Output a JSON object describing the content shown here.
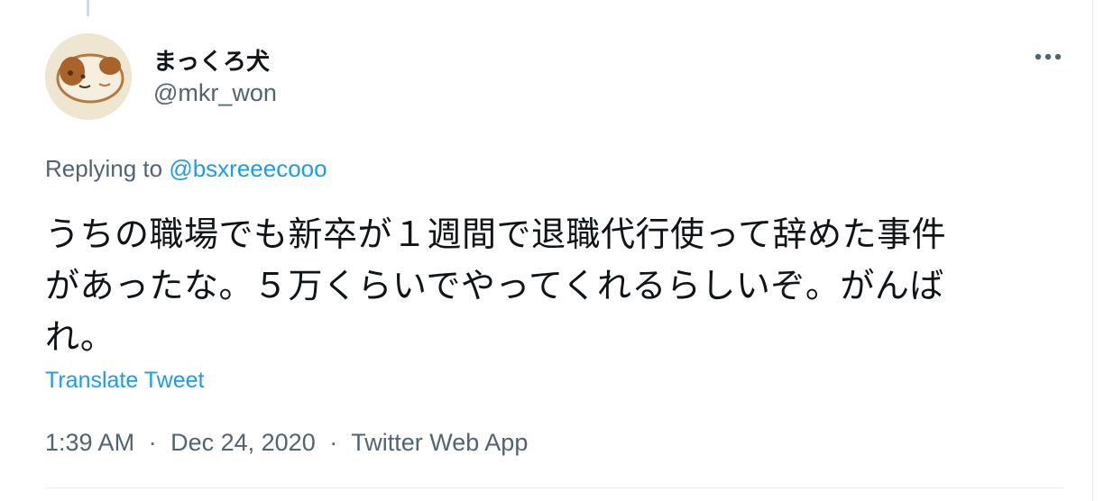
{
  "tweet": {
    "author": {
      "display_name": "まっくろ犬",
      "handle": "@mkr_won"
    },
    "replying": {
      "prefix": "Replying to",
      "mention": "@bsxreeecooo"
    },
    "text_lines": [
      "うちの職場でも新卒が１週間で退職代行使って辞めた事件",
      "があったな。５万くらいでやってくれるらしいぞ。がんば",
      "れ。"
    ],
    "translate_label": "Translate Tweet",
    "meta": {
      "time": "1:39 AM",
      "separator": "·",
      "date": "Dec 24, 2020",
      "source": "Twitter Web App"
    },
    "more_icon": "more-horizontal-icon"
  },
  "colors": {
    "text": "#0f1419",
    "secondary": "#536471",
    "accent": "#1d9bf0",
    "border": "#ebeef0"
  }
}
